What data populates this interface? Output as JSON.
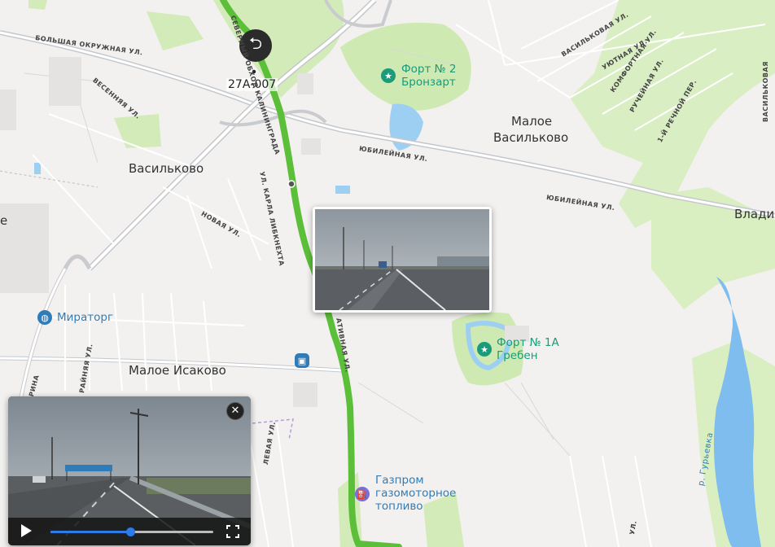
{
  "route": {
    "label": "27А-007"
  },
  "towns": {
    "vasilkovo": "Васильково",
    "maloe_vasilkovo_1": "Малое",
    "maloe_vasilkovo_2": "Васильково",
    "maloe_isakovo": "Малое Исаково",
    "vladi": "Влади",
    "edge_e": "е"
  },
  "streets": {
    "bolshaya_okruzhnaya": "БОЛЬШАЯ ОКРУЖНАЯ УЛ.",
    "vesennyaya": "ВЕСЕННЯЯ УЛ.",
    "severny": "СЕВЕРНЫЙ ОБХОД КАЛИНИНГРАДА",
    "karla_libknekhta": "УЛ. КАРЛА ЛИБКНЕХТА",
    "novaya": "НОВАЯ УЛ.",
    "yubileynaya_1": "ЮБИЛЕЙНАЯ УЛ.",
    "yubileynaya_2": "ЮБИЛЕЙНАЯ УЛ.",
    "vasilkovaya": "ВАСИЛЬКОВАЯ УЛ.",
    "uyutnaya": "УЮТНАЯ УЛ.",
    "komfortnaya": "КОМФОРТНАЯ УЛ.",
    "ruchejnaya": "РУЧЕЙНАЯ УЛ.",
    "rechnoy_per": "1-Й РЕЧНОЙ ПЕР.",
    "vasilkovaya_2": "ВАСИЛЬКОВАЯ",
    "kooperativnaya": "АТИВНАЯ УЛ.",
    "krainyaya": "РАЙНЯЯ УЛ.",
    "rina": "РИНА",
    "polevaya": "ЛЕВАЯ УЛ.",
    "r_guryevka": "р. Гурьевка",
    "edge_ul": "УЛ."
  },
  "pois": {
    "fort2_line1": "Форт № 2",
    "fort2_line2": "Бронзарт",
    "fort1a_line1": "Форт № 1А",
    "fort1a_line2": "Гребен",
    "miratorg": "Мираторг",
    "gazprom_line1": "Газпром",
    "gazprom_line2": "газомоторное",
    "gazprom_line3": "топливо"
  },
  "player": {
    "progress": 0.49
  },
  "colors": {
    "route": "#5cbf3a",
    "park": "#cde9b0",
    "water": "#8fc6f0",
    "road": "#ffffff",
    "poi_text": "#1a9b79",
    "accent": "#2e7ae6"
  }
}
